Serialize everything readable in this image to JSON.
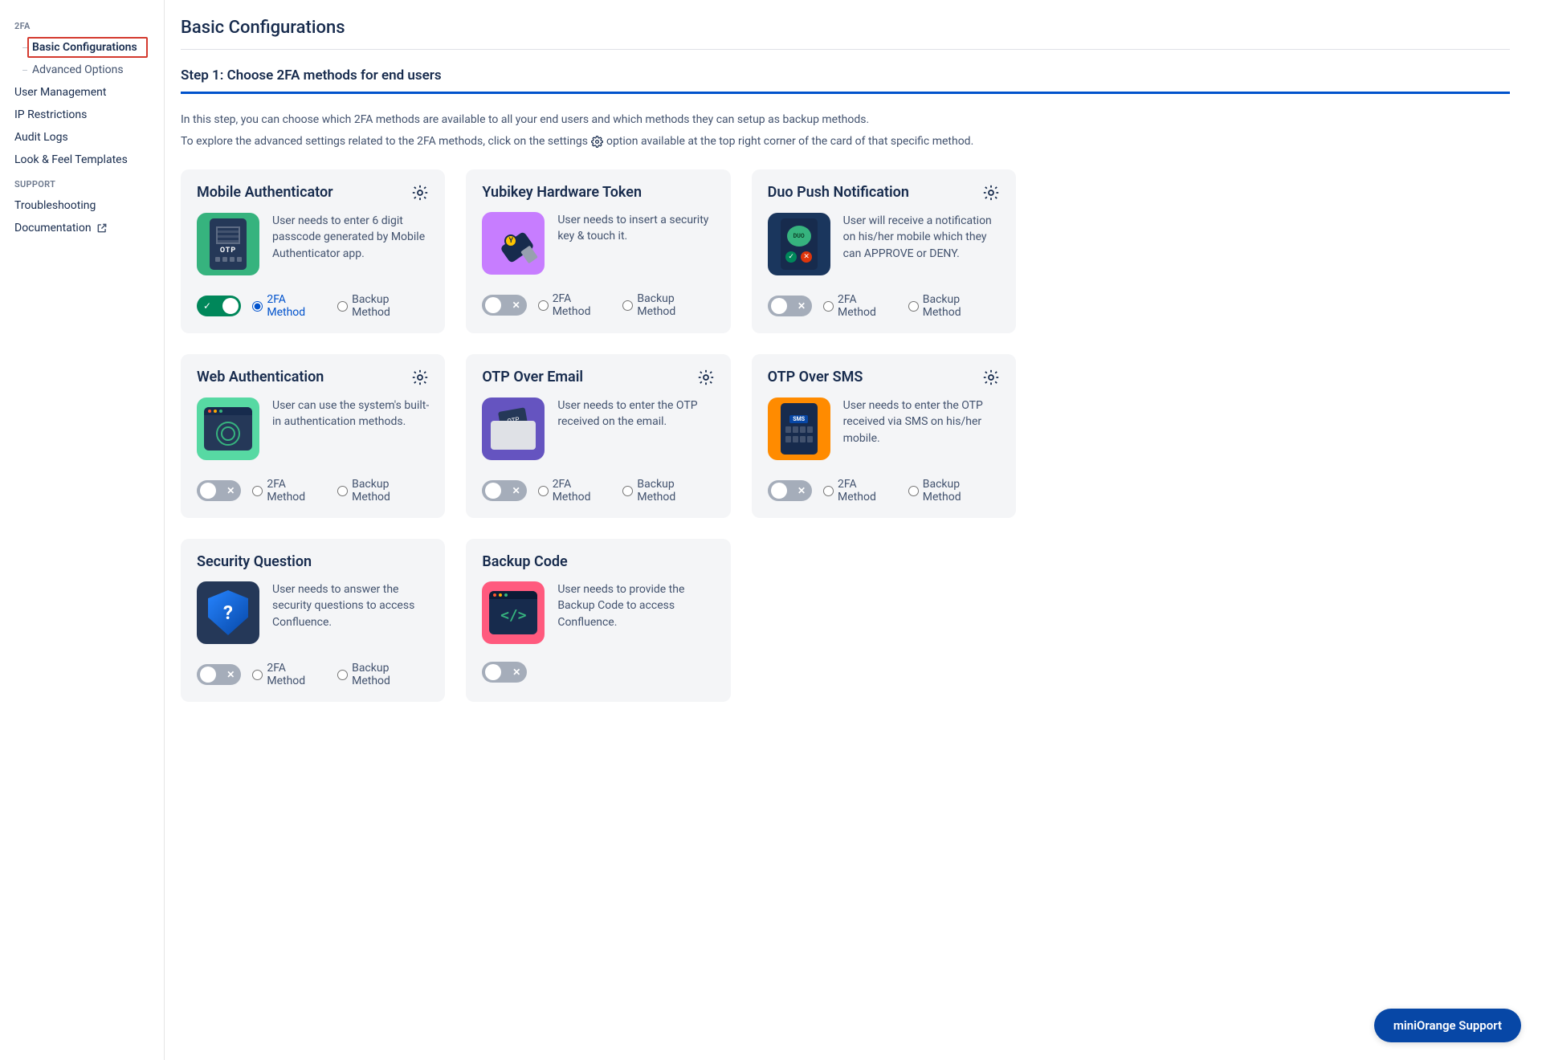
{
  "sidebar": {
    "section_2fa": "2FA",
    "basic_config": "Basic Configurations",
    "advanced_options": "Advanced Options",
    "user_management": "User Management",
    "ip_restrictions": "IP Restrictions",
    "audit_logs": "Audit Logs",
    "look_feel": "Look & Feel Templates",
    "section_support": "SUPPORT",
    "troubleshooting": "Troubleshooting",
    "documentation": "Documentation"
  },
  "page": {
    "title": "Basic Configurations",
    "step_title": "Step 1: Choose 2FA methods for end users",
    "intro_line1": "In this step, you can choose which 2FA methods are available to all your end users and which methods they can setup as backup methods.",
    "intro_line2a": "To explore the advanced settings related to the 2FA methods, click on the settings",
    "intro_line2b": "option available at the top right corner of the card of that specific method."
  },
  "labels": {
    "method_2fa": "2FA Method",
    "method_backup": "Backup Method"
  },
  "cards": {
    "mobile_auth": {
      "title": "Mobile Authenticator",
      "desc": "User needs to enter 6 digit passcode generated by Mobile Authenticator app.",
      "enabled": true,
      "selected": "2fa",
      "has_gear": true,
      "has_radios": true
    },
    "yubikey": {
      "title": "Yubikey Hardware Token",
      "desc": "User needs to insert a security key & touch it.",
      "enabled": false,
      "selected": null,
      "has_gear": false,
      "has_radios": true
    },
    "duo": {
      "title": "Duo Push Notification",
      "desc": "User will receive a notification on his/her mobile which they can APPROVE or DENY.",
      "enabled": false,
      "selected": null,
      "has_gear": true,
      "has_radios": true
    },
    "webauthn": {
      "title": "Web Authentication",
      "desc": "User can use the system's built-in authentication methods.",
      "enabled": false,
      "selected": null,
      "has_gear": true,
      "has_radios": true
    },
    "otp_email": {
      "title": "OTP Over Email",
      "desc": "User needs to enter the OTP received on the email.",
      "enabled": false,
      "selected": null,
      "has_gear": true,
      "has_radios": true
    },
    "otp_sms": {
      "title": "OTP Over SMS",
      "desc": "User needs to enter the OTP received via SMS on his/her mobile.",
      "enabled": false,
      "selected": null,
      "has_gear": true,
      "has_radios": true
    },
    "security_q": {
      "title": "Security Question",
      "desc": "User needs to answer the security questions to access Confluence.",
      "enabled": false,
      "selected": null,
      "has_gear": false,
      "has_radios": true
    },
    "backup_code": {
      "title": "Backup Code",
      "desc": "User needs to provide the Backup Code to access Confluence.",
      "enabled": false,
      "selected": null,
      "has_gear": false,
      "has_radios": false
    }
  },
  "support_fab": "miniOrange Support"
}
